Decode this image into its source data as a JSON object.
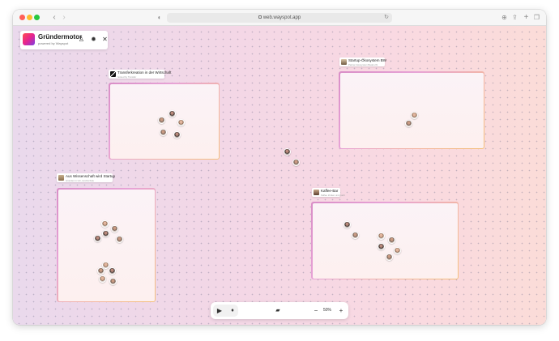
{
  "browser": {
    "url": "web.wayspot.app",
    "icons": {
      "back": "chevron-left-icon",
      "forward": "chevron-right-icon",
      "sidebar": "sidebar-icon",
      "shield": "shield-icon",
      "reload": "reload-icon",
      "download": "download-icon",
      "share": "share-icon",
      "new_tab": "plus-icon",
      "tabs": "tabs-overview-icon"
    }
  },
  "brand": {
    "title": "Gründermotor",
    "subtitle": "powered by Wayspot",
    "icons": [
      "accessibility-icon",
      "gear-icon",
      "close-icon"
    ]
  },
  "rooms": [
    {
      "title": "Transferkreation in der Wirtschaft",
      "subtitle": "hosted by Transfer"
    },
    {
      "title": "Startup-Ökosystem BW",
      "subtitle": "Partner Ecosystem Baden-W."
    },
    {
      "title": "Aus Wissenschaft wird Startup",
      "subtitle": "Gründen in Uni, Hochschule"
    },
    {
      "title": "Kaffee-Bar",
      "subtitle": "Kaffee trinken und mehr"
    }
  ],
  "toolbar": {
    "zoom": "50%",
    "zoom_out": "−",
    "zoom_in": "+",
    "icons": [
      "camera-icon",
      "microphone-icon",
      "chat-icon"
    ]
  },
  "colors": {
    "brand_gradient": [
      "#ff4e50",
      "#e6238e",
      "#7b3fe4"
    ],
    "room_border": [
      "#d98ec7",
      "#f4c07a"
    ]
  }
}
